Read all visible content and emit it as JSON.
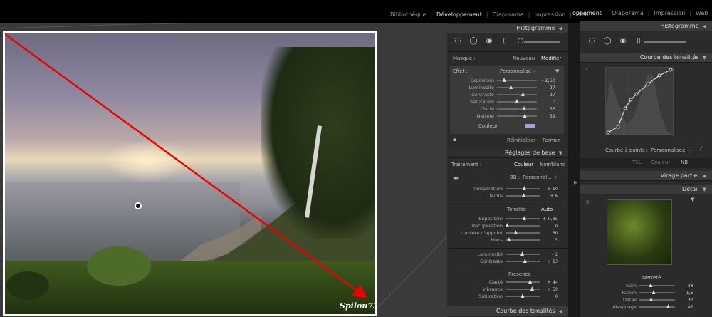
{
  "nav_left": {
    "items": [
      "Bibliothèque",
      "Développement",
      "Diaporama",
      "Impression",
      "Web"
    ],
    "active_index": 1
  },
  "nav_right": {
    "items": [
      "oppement",
      "Diaporama",
      "Impression",
      "Web"
    ],
    "active_index": 0
  },
  "photo": {
    "watermark": "Spilou73"
  },
  "left_panel": {
    "histogram_title": "Histogramme",
    "masque_label": "Masque :",
    "masque_new": "Nouveau",
    "masque_edit": "Modifier",
    "effect_label": "Effet :",
    "effect_value": "Personnalisé ÷",
    "sliders": [
      {
        "label": "Exposition",
        "value": "– 2,50",
        "pos": 0.18
      },
      {
        "label": "Luminosité",
        "value": "– 27",
        "pos": 0.35
      },
      {
        "label": "Contraste",
        "value": "27",
        "pos": 0.65
      },
      {
        "label": "Saturation",
        "value": "0",
        "pos": 0.5
      },
      {
        "label": "Clarté",
        "value": "36",
        "pos": 0.68
      },
      {
        "label": "Netteté",
        "value": "39",
        "pos": 0.7
      }
    ],
    "couleur_label": "Couleur",
    "reset": "Réinitialiser",
    "close": "Fermer",
    "basic_title": "Réglages de base",
    "traitement_label": "Traitement :",
    "couleur": "Couleur",
    "noirblanc": "Noir/blanc",
    "bb_label": "BB :",
    "bb_value": "Personnal... ÷",
    "temp_sliders": [
      {
        "label": "Température",
        "value": "+ 10",
        "pos": 0.55
      },
      {
        "label": "Teinte",
        "value": "+ 6",
        "pos": 0.53
      }
    ],
    "tone_label": "Tonalité",
    "tone_auto": "Auto",
    "tone_sliders": [
      {
        "label": "Exposition",
        "value": "+ 0,35",
        "pos": 0.55
      },
      {
        "label": "Récupération",
        "value": "0",
        "pos": 0.05
      },
      {
        "label": "Lumière d'appoint",
        "value": "30",
        "pos": 0.3
      },
      {
        "label": "Noirs",
        "value": "5",
        "pos": 0.1
      }
    ],
    "lum_sliders": [
      {
        "label": "Luminosité",
        "value": "– 2",
        "pos": 0.49
      },
      {
        "label": "Contraste",
        "value": "+ 13",
        "pos": 0.57
      }
    ],
    "presence_label": "Présence",
    "presence_sliders": [
      {
        "label": "Clarté",
        "value": "+ 44",
        "pos": 0.72
      },
      {
        "label": "Vibrance",
        "value": "+ 59",
        "pos": 0.78
      },
      {
        "label": "Saturation",
        "value": "0",
        "pos": 0.5
      }
    ],
    "curve_title": "Courbe des tonalités"
  },
  "right_panel": {
    "histogram_title": "Histogramme",
    "curve_title": "Courbe des tonalités",
    "curve_points_label": "Courbe à points :",
    "curve_points_value": "Personnalisée ÷",
    "tsl_tabs": [
      "TSL",
      "Couleur",
      "NB"
    ],
    "split_title": "Virage partiel",
    "detail_title": "Détail",
    "sharpen_label": "Netteté",
    "sharpen_sliders": [
      {
        "label": "Gain",
        "value": "48",
        "pos": 0.32
      },
      {
        "label": "Rayon",
        "value": "1,5",
        "pos": 0.4
      },
      {
        "label": "Détail",
        "value": "33",
        "pos": 0.33
      },
      {
        "label": "Masquage",
        "value": "81",
        "pos": 0.81
      }
    ]
  }
}
